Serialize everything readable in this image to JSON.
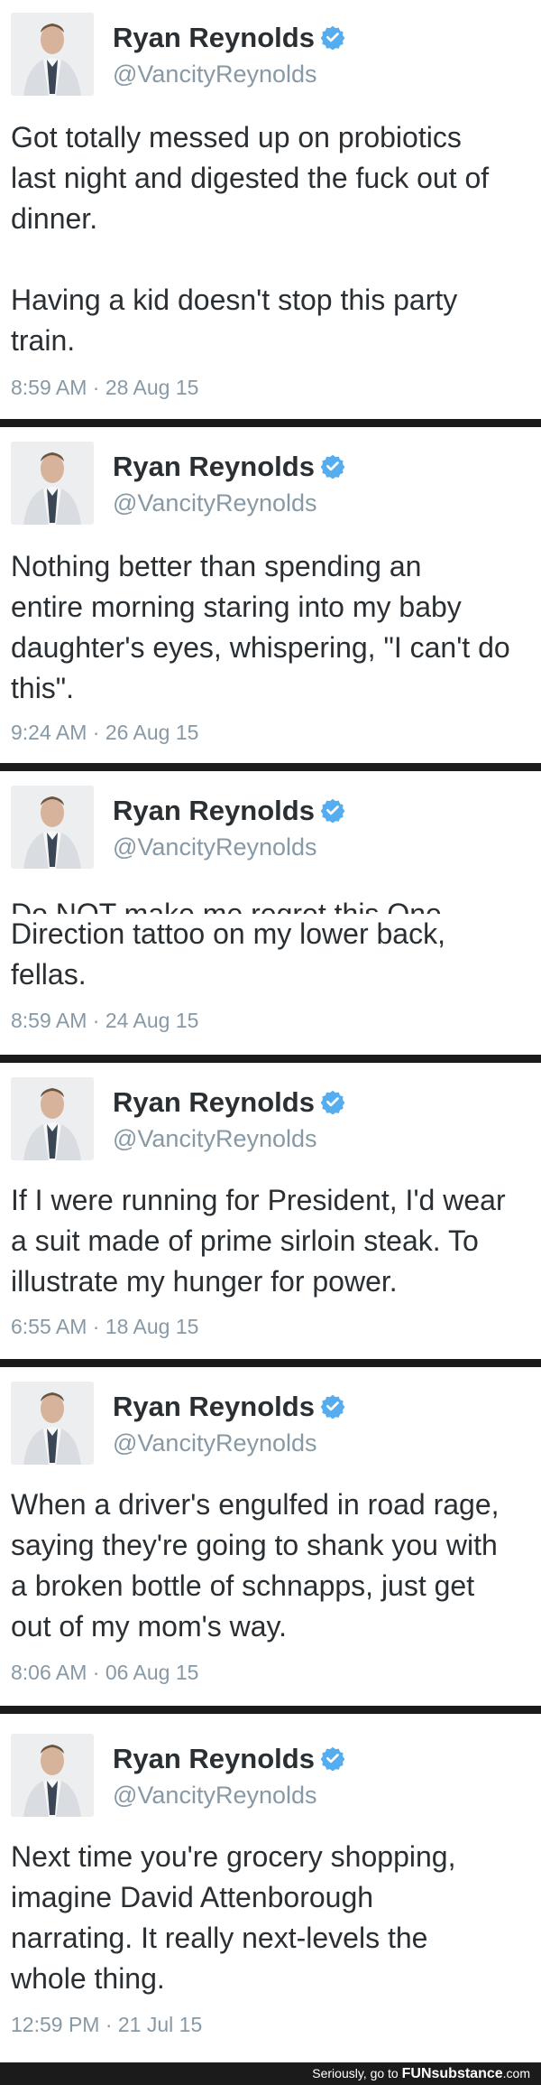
{
  "colors": {
    "name": "#292f33",
    "handle": "#8899a6",
    "verified": "#55acee",
    "divider": "#1b1b1b"
  },
  "tweets": [
    {
      "name": "Ryan Reynolds",
      "handle": "@VancityReynolds",
      "text": "Got totally messed up on probiotics\nlast night and digested the fuck out of\ndinner.\n\nHaving a kid doesn't stop this party\ntrain.",
      "time": "8:59 AM · 28 Aug 15"
    },
    {
      "name": "Ryan Reynolds",
      "handle": "@VancityReynolds",
      "text": "Nothing better than spending an\nentire morning staring into my baby\ndaughter's eyes, whispering, \"I can't do\nthis\".",
      "time": "9:24 AM · 26 Aug 15"
    },
    {
      "name": "Ryan Reynolds",
      "handle": "@VancityReynolds",
      "text_line1": "Do NOT make me regret this One",
      "text_rest": "Direction tattoo on my lower back,\nfellas.",
      "time": "8:59 AM · 24 Aug 15"
    },
    {
      "name": "Ryan Reynolds",
      "handle": "@VancityReynolds",
      "text": "If I were running for President, I'd wear\na suit made of prime sirloin steak. To\nillustrate my hunger for power.",
      "time": "6:55 AM · 18 Aug 15"
    },
    {
      "name": "Ryan Reynolds",
      "handle": "@VancityReynolds",
      "text": "When a driver's engulfed in road rage,\nsaying they're going to shank you with\na broken bottle of schnapps, just get\nout of my mom's way.",
      "time": "8:06 AM · 06 Aug 15"
    },
    {
      "name": "Ryan Reynolds",
      "handle": "@VancityReynolds",
      "text": "Next time you're grocery shopping,\nimagine David Attenborough\nnarrating. It really next-levels the\nwhole thing.",
      "time": "12:59 PM · 21 Jul 15"
    }
  ],
  "footer": {
    "prefix": "Seriously, go to ",
    "brand": "FUNsubstance",
    "suffix": ".com"
  }
}
